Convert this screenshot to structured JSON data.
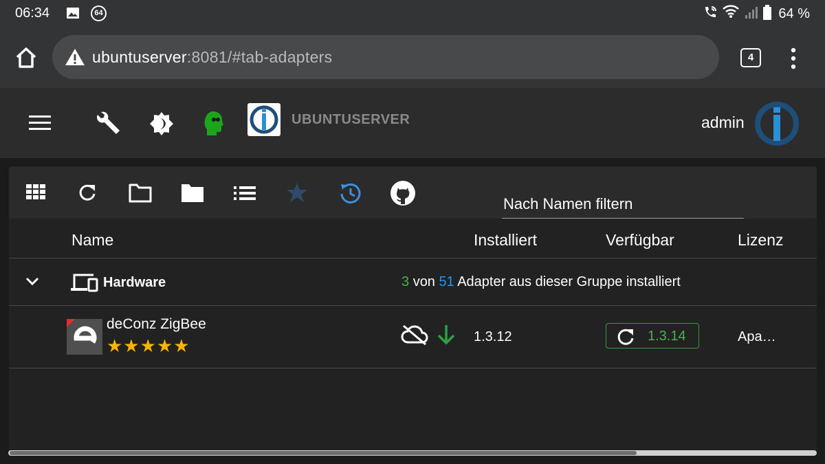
{
  "status_bar": {
    "time": "06:34",
    "notification_badge": "64",
    "battery": "64 %"
  },
  "browser": {
    "url_host": "ubuntuserver",
    "url_path": ":8081/#tab-adapters",
    "tab_count": "4"
  },
  "header": {
    "host": "UBUNTUSERVER",
    "user": "admin"
  },
  "colors": {
    "accent_blue": "#2196f3",
    "success_green": "#4caf50",
    "star_gold": "#f5b400",
    "expert_green": "#1ba51b"
  },
  "toolbar": {
    "icons": [
      "grid-view-icon",
      "refresh-icon",
      "folder-outline-icon",
      "folder-icon",
      "list-icon",
      "star-icon",
      "update-clock-icon",
      "github-icon"
    ],
    "filter_placeholder": "Nach Namen filtern"
  },
  "table": {
    "columns": {
      "name": "Name",
      "installed": "Installiert",
      "available": "Verfügbar",
      "license": "Lizenz"
    },
    "group": {
      "name": "Hardware",
      "installed_count": "3",
      "connector": "von",
      "total_count": "51",
      "summary_suffix": "Adapter aus dieser Gruppe installiert"
    },
    "adapter": {
      "name": "deConz ZigBee",
      "stars": "★★★★★",
      "installed_version": "1.3.12",
      "available_version": "1.3.14",
      "license": "Apa…"
    }
  }
}
